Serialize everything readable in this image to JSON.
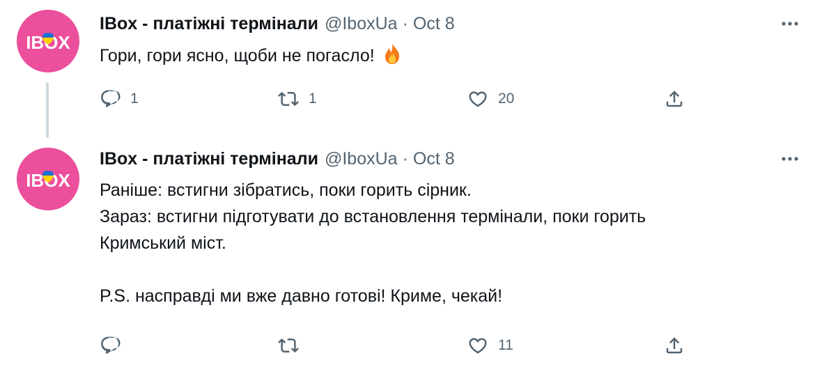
{
  "tweets": [
    {
      "author": {
        "display_name": "IBox - платіжні термінали",
        "handle": "@IboxUa",
        "avatar_text": "IBOX"
      },
      "separator": "·",
      "date": "Oct 8",
      "text_lines": [
        "Гори, гори ясно, щоби не погасло!"
      ],
      "emoji": "fire",
      "actions": {
        "reply_count": "1",
        "retweet_count": "1",
        "like_count": "20"
      }
    },
    {
      "author": {
        "display_name": "IBox - платіжні термінали",
        "handle": "@IboxUa",
        "avatar_text": "IBOX"
      },
      "separator": "·",
      "date": "Oct 8",
      "text_lines": [
        "Раніше: встигни зібратись, поки горить сірник.",
        "Зараз: встигни підготувати до встановлення термінали, поки горить",
        "Кримський міст.",
        "",
        "P.S. насправді ми вже давно готові! Криме, чекай!"
      ],
      "actions": {
        "reply_count": "",
        "retweet_count": "",
        "like_count": "11"
      }
    }
  ],
  "colors": {
    "avatar_bg": "#ec4f9c",
    "text_primary": "#0f1419",
    "text_secondary": "#536471",
    "thread_line": "#cfd9de",
    "flag_blue": "#1d6fd6",
    "flag_yellow": "#ffd400"
  },
  "icons": {
    "reply": "reply-icon",
    "retweet": "retweet-icon",
    "like": "like-icon",
    "share": "share-icon",
    "more": "more-icon",
    "emoji": "fire-emoji"
  }
}
